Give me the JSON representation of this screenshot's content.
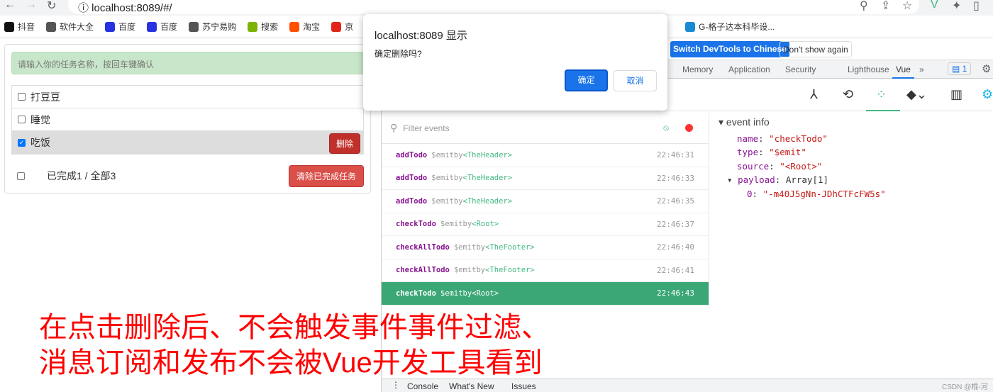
{
  "browser": {
    "url": "localhost:8089/#/",
    "bookmarks": [
      {
        "label": "抖音",
        "color": "#111"
      },
      {
        "label": "软件大全",
        "color": "#555"
      },
      {
        "label": "百度",
        "color": "#2932e1"
      },
      {
        "label": "百度",
        "color": "#2932e1"
      },
      {
        "label": "苏宁易购",
        "color": "#555"
      },
      {
        "label": "搜索",
        "color": "#7cb305"
      },
      {
        "label": "淘宝",
        "color": "#ff5000"
      },
      {
        "label": "京",
        "color": "#e1251b"
      }
    ],
    "bookmark_extra": "G-格子达本科毕设..."
  },
  "app": {
    "input_placeholder": "请输入你的任务名称，按回车键确认",
    "todos": [
      {
        "title": "打豆豆",
        "done": false
      },
      {
        "title": "睡觉",
        "done": false
      },
      {
        "title": "吃饭",
        "done": true,
        "delete_label": "删除"
      }
    ],
    "footer": {
      "status": "已完成1 / 全部3",
      "clear_label": "清除已完成任务"
    }
  },
  "dialog": {
    "title": "localhost:8089 显示",
    "message": "确定删除吗?",
    "ok": "确定",
    "cancel": "取消"
  },
  "devtools": {
    "banner": {
      "switch": "Switch DevTools to Chinese",
      "dismiss": "Don't show again"
    },
    "tabs": [
      "Memory",
      "Application",
      "Security",
      "Lighthouse",
      "Vue"
    ],
    "active_tab": "Vue",
    "issues_count": "1",
    "filter_placeholder": "Filter events",
    "events": [
      {
        "name": "addTodo",
        "type": "$emit",
        "by": "by",
        "source": "<TheHeader>",
        "time": "22:46:31"
      },
      {
        "name": "addTodo",
        "type": "$emit",
        "by": "by",
        "source": "<TheHeader>",
        "time": "22:46:33"
      },
      {
        "name": "addTodo",
        "type": "$emit",
        "by": "by",
        "source": "<TheHeader>",
        "time": "22:46:35"
      },
      {
        "name": "checkTodo",
        "type": "$emit",
        "by": "by",
        "source": "<Root>",
        "time": "22:46:37"
      },
      {
        "name": "checkAllTodo",
        "type": "$emit",
        "by": "by",
        "source": "<TheFooter>",
        "time": "22:46:40"
      },
      {
        "name": "checkAllTodo",
        "type": "$emit",
        "by": "by",
        "source": "<TheFooter>",
        "time": "22:46:41"
      },
      {
        "name": "checkTodo",
        "type": "$emit",
        "by": "by",
        "source": "<Root>",
        "time": "22:46:43",
        "selected": true
      }
    ],
    "info": {
      "header": "event info",
      "name": "\"checkTodo\"",
      "type": "\"$emit\"",
      "source": "\"<Root>\"",
      "payload": "Array[1]",
      "item0": "\"-m40J5gNn-JDhCTFcFW5s\""
    },
    "drawer_tabs": [
      "Console",
      "What's New",
      "Issues"
    ]
  },
  "caption": {
    "line1": "在点击删除后、不会触发事件事件过滤、",
    "line2": "消息订阅和发布不会被Vue开发工具看到"
  },
  "watermark": "CSDN @棍-河"
}
